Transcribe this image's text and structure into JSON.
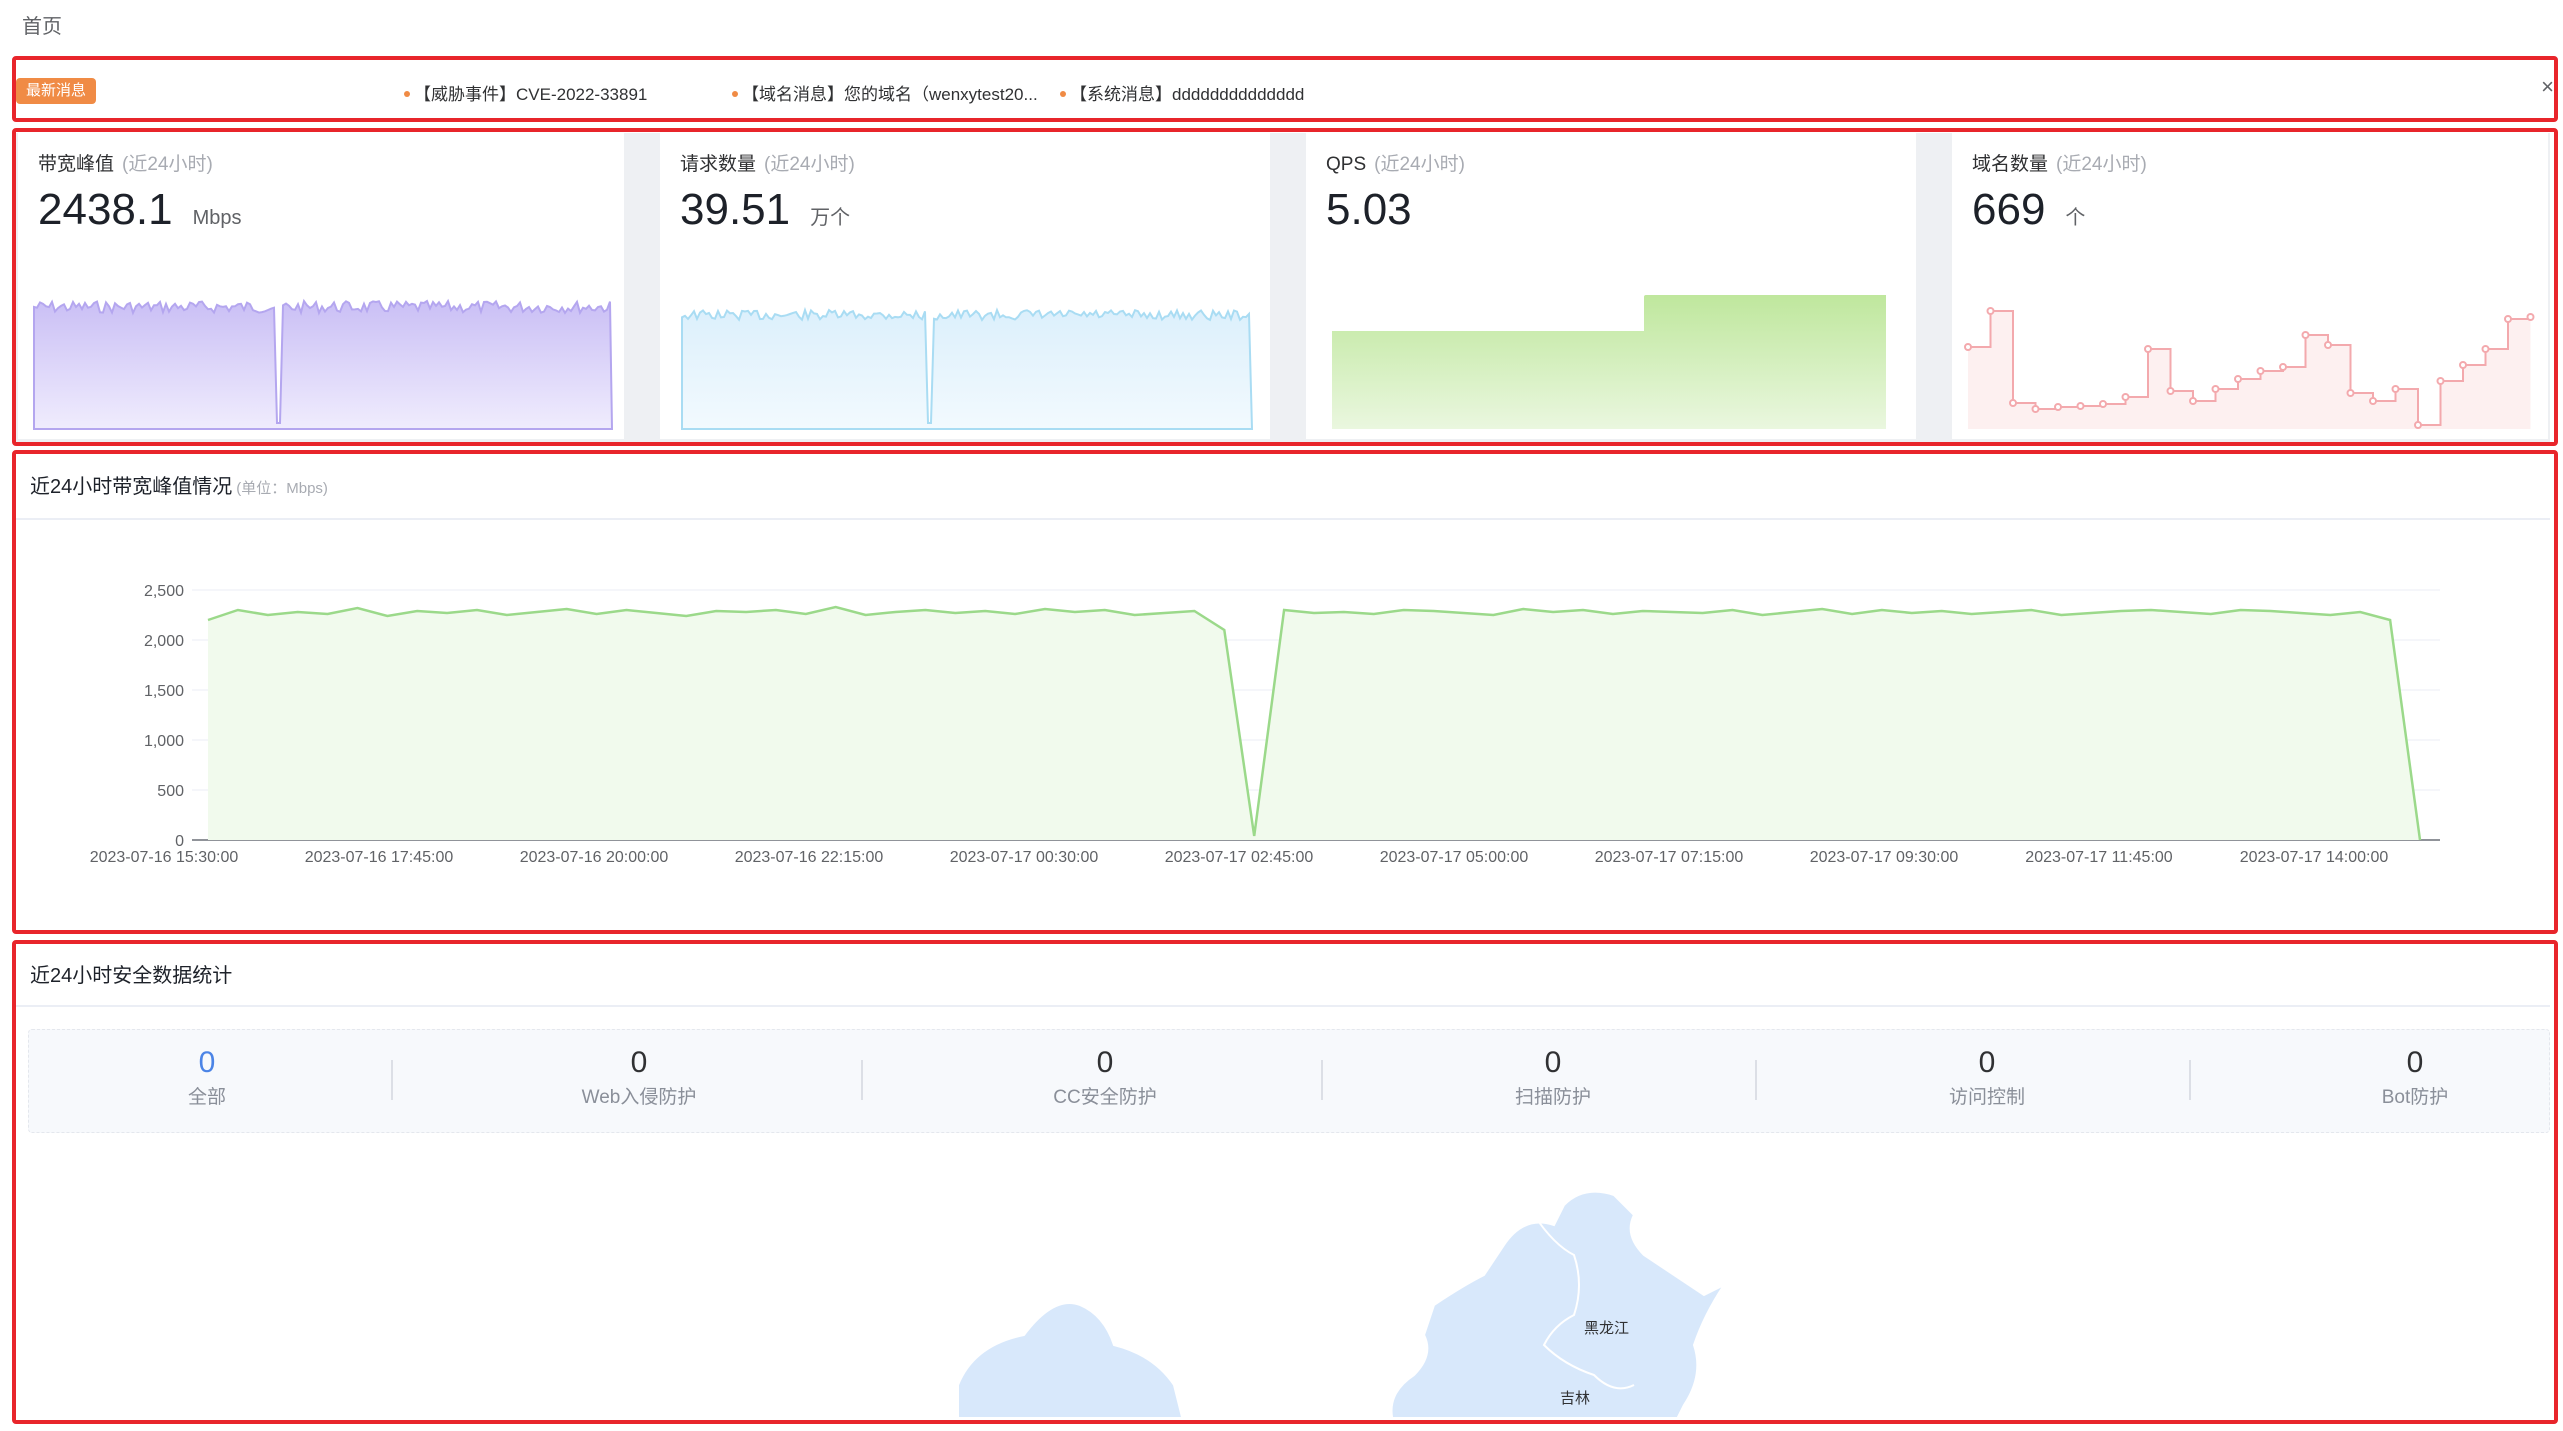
{
  "breadcrumb": "首页",
  "news": {
    "badge": "最新消息",
    "items": [
      "【威胁事件】CVE-2022-33891",
      "【域名消息】您的域名（wenxytest20...",
      "【系统消息】dddddddddddddd"
    ],
    "close_icon": "close-icon"
  },
  "cards": [
    {
      "title": "带宽峰值",
      "sub": "(近24小时)",
      "value": "2438.1",
      "unit": "Mbps",
      "color": "#b4a6ef"
    },
    {
      "title": "请求数量",
      "sub": "(近24小时)",
      "value": "39.51",
      "unit": "万个",
      "color": "#a9dcf3"
    },
    {
      "title": "QPS",
      "sub": "(近24小时)",
      "value": "5.03",
      "unit": "",
      "color": "#b9e49a"
    },
    {
      "title": "域名数量",
      "sub": "(近24小时)",
      "value": "669",
      "unit": "个",
      "color": "#f3a9ad"
    }
  ],
  "bandwidth": {
    "title": "近24小时带宽峰值情况",
    "sub": "(单位：Mbps)"
  },
  "chart_data": {
    "type": "area",
    "title": "近24小时带宽峰值情况",
    "ylabel": "",
    "xlabel": "",
    "ylim": [
      0,
      2500
    ],
    "yticks": [
      0,
      500,
      1000,
      1500,
      2000,
      2500
    ],
    "ytick_labels": [
      "0",
      "500",
      "1,000",
      "1,500",
      "2,000",
      "2,500"
    ],
    "x_tick_labels": [
      "2023-07-16 15:30:00",
      "2023-07-16 17:45:00",
      "2023-07-16 20:00:00",
      "2023-07-16 22:15:00",
      "2023-07-17 00:30:00",
      "2023-07-17 02:45:00",
      "2023-07-17 05:00:00",
      "2023-07-17 07:15:00",
      "2023-07-17 09:30:00",
      "2023-07-17 11:45:00",
      "2023-07-17 14:00:00"
    ],
    "series": [
      {
        "values": [
          2200,
          2300,
          2250,
          2280,
          2260,
          2320,
          2240,
          2290,
          2270,
          2300,
          2250,
          2280,
          2310,
          2260,
          2300,
          2270,
          2240,
          2290,
          2280,
          2300,
          2260,
          2330,
          2250,
          2280,
          2300,
          2270,
          2290,
          2260,
          2310,
          2280,
          2300,
          2250,
          2270,
          2290,
          2100,
          40,
          2300,
          2270,
          2280,
          2260,
          2300,
          2290,
          2270,
          2250,
          2310,
          2280,
          2300,
          2260,
          2290,
          2280,
          2270,
          2300,
          2250,
          2280,
          2310,
          2260,
          2300,
          2270,
          2290,
          2260,
          2280,
          2300,
          2250,
          2270,
          2290,
          2300,
          2280,
          2260,
          2300,
          2290,
          2270,
          2250,
          2280,
          2200,
          0
        ]
      }
    ],
    "grid": true,
    "color": "#9bd98a"
  },
  "security": {
    "title": "近24小时安全数据统计",
    "stats": [
      {
        "num": "0",
        "label": "全部"
      },
      {
        "num": "0",
        "label": "Web入侵防护"
      },
      {
        "num": "0",
        "label": "CC安全防护"
      },
      {
        "num": "0",
        "label": "扫描防护"
      },
      {
        "num": "0",
        "label": "访问控制"
      },
      {
        "num": "0",
        "label": "Bot防护"
      }
    ],
    "map_labels": [
      "黑龙江",
      "吉林"
    ]
  }
}
